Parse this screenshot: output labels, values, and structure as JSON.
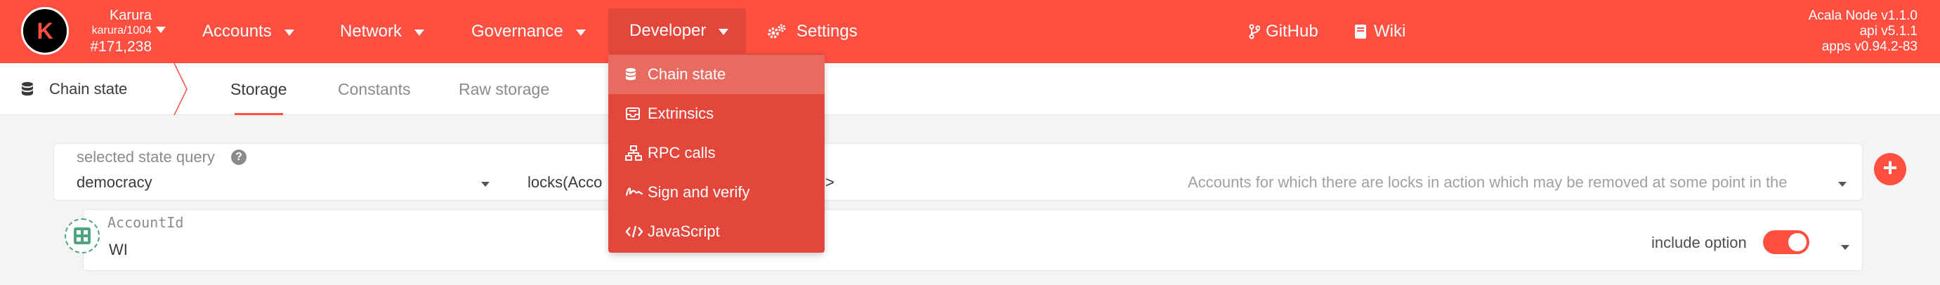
{
  "chain": {
    "name": "Karura",
    "node": "karura/1004",
    "block": "#171,238",
    "logo_letter": "K"
  },
  "nav": {
    "accounts": "Accounts",
    "network": "Network",
    "governance": "Governance",
    "developer": "Developer",
    "settings": "Settings",
    "github": "GitHub",
    "wiki": "Wiki"
  },
  "version": {
    "node": "Acala Node v1.1.0",
    "api": "api v5.1.1",
    "apps": "apps v0.94.2-83"
  },
  "subnav": {
    "section": "Chain state",
    "tabs": [
      "Storage",
      "Constants",
      "Raw storage"
    ],
    "active_tab": "Storage"
  },
  "query": {
    "label": "selected state query",
    "module": "democracy",
    "method": "locks(Acco",
    "method_tail": ">",
    "description": "Accounts for which there are locks in action which may be removed at some point in the"
  },
  "param": {
    "label": "AccountId",
    "value": "WI",
    "include_option": "include option",
    "include_option_on": true
  },
  "developer_menu": {
    "items": [
      {
        "label": "Chain state",
        "icon": "database-icon",
        "active": true
      },
      {
        "label": "Extrinsics",
        "icon": "inbox-icon",
        "active": false
      },
      {
        "label": "RPC calls",
        "icon": "network-icon",
        "active": false
      },
      {
        "label": "Sign and verify",
        "icon": "signature-icon",
        "active": false
      },
      {
        "label": "JavaScript",
        "icon": "code-icon",
        "active": false
      }
    ]
  },
  "colors": {
    "accent": "#ff4f41",
    "menu_bg": "#e3463a",
    "identicon": "#4fa47f"
  }
}
